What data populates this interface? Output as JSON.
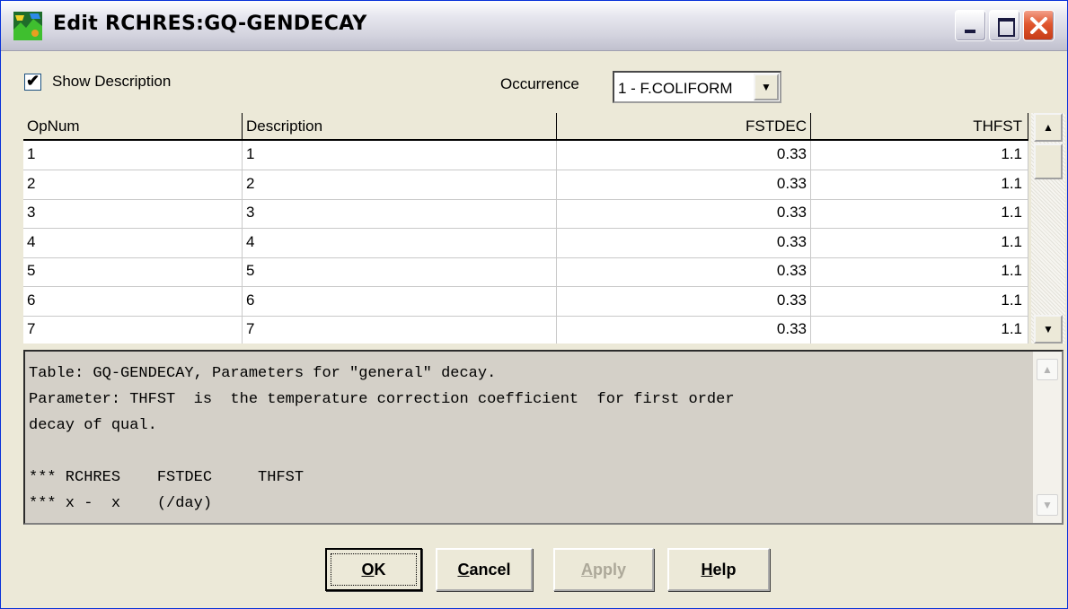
{
  "window": {
    "title": "Edit RCHRES:GQ-GENDECAY"
  },
  "options": {
    "show_description_label": "Show Description",
    "show_description_checked": true,
    "occurrence_label": "Occurrence",
    "occurrence_value": "1 - F.COLIFORM"
  },
  "grid": {
    "headers": [
      "OpNum",
      "Description",
      "FSTDEC",
      "THFST"
    ],
    "rows": [
      [
        "1",
        "1",
        "0.33",
        "1.1"
      ],
      [
        "2",
        "2",
        "0.33",
        "1.1"
      ],
      [
        "3",
        "3",
        "0.33",
        "1.1"
      ],
      [
        "4",
        "4",
        "0.33",
        "1.1"
      ],
      [
        "5",
        "5",
        "0.33",
        "1.1"
      ],
      [
        "6",
        "6",
        "0.33",
        "1.1"
      ],
      [
        "7",
        "7",
        "0.33",
        "1.1"
      ]
    ]
  },
  "description": {
    "lines": [
      "Table: GQ-GENDECAY, Parameters for \"general\" decay.",
      "Parameter: THFST  is  the temperature correction coefficient  for first order",
      "decay of qual.",
      "",
      "*** RCHRES    FSTDEC     THFST",
      "*** x -  x    (/day)"
    ]
  },
  "buttons": {
    "ok": {
      "mnemonic": "O",
      "rest": "K"
    },
    "cancel": {
      "mnemonic": "C",
      "rest": "ancel"
    },
    "apply": {
      "mnemonic": "A",
      "rest": "pply"
    },
    "help": {
      "mnemonic": "H",
      "rest": "elp"
    }
  },
  "icons": {
    "app": "map-icon",
    "minimize": "minimize-icon",
    "maximize": "maximize-icon",
    "close": "close-icon"
  }
}
